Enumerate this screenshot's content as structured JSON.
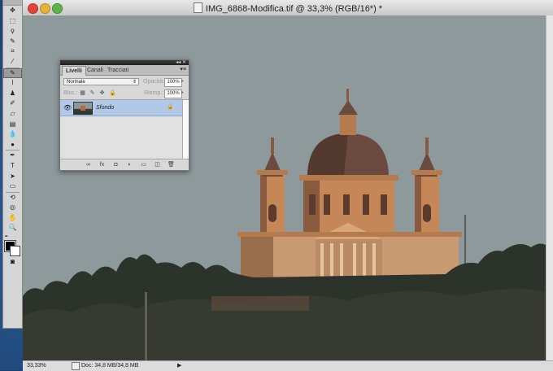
{
  "window": {
    "title": "IMG_6868-Modifica.tif @ 33,3% (RGB/16*) *"
  },
  "statusbar": {
    "zoom": "33,33%",
    "doc_info": "Doc: 34,8 MB/34,8 MB"
  },
  "toolbar": {
    "tools": [
      {
        "name": "move-tool"
      },
      {
        "name": "marquee-tool"
      },
      {
        "name": "lasso-tool"
      },
      {
        "name": "quick-selection-tool"
      },
      {
        "name": "crop-tool"
      },
      {
        "name": "eyedropper-tool"
      },
      {
        "name": "spot-healing-tool",
        "active": true
      },
      {
        "name": "brush-tool"
      },
      {
        "name": "clone-stamp-tool"
      },
      {
        "name": "history-brush-tool"
      },
      {
        "name": "eraser-tool"
      },
      {
        "name": "gradient-tool"
      },
      {
        "name": "blur-tool"
      },
      {
        "name": "dodge-tool"
      },
      {
        "name": "pen-tool"
      },
      {
        "name": "type-tool"
      },
      {
        "name": "path-selection-tool"
      },
      {
        "name": "shape-tool"
      },
      {
        "name": "3d-rotate-tool"
      },
      {
        "name": "3d-orbit-tool"
      },
      {
        "name": "hand-tool"
      },
      {
        "name": "zoom-tool"
      }
    ]
  },
  "layers_panel": {
    "tabs": [
      "Livelli",
      "Canali",
      "Tracciati"
    ],
    "active_tab": "Livelli",
    "blend_mode": "Normale",
    "opacity_label": "Opacità:",
    "opacity_value": "100%",
    "lock_label": "Bloc.:",
    "fill_label": "Riemp.:",
    "fill_value": "100%",
    "layers": [
      {
        "name": "Sfondo",
        "visible": true,
        "locked": true,
        "selected": true
      }
    ]
  },
  "colors": {
    "sky": "#8e999c",
    "building_lit": "#c58758",
    "building_shadow": "#8a5a3e",
    "dome": "#6b4a40",
    "trees": "#2c332b",
    "selected_layer": "#b1c8e8"
  }
}
